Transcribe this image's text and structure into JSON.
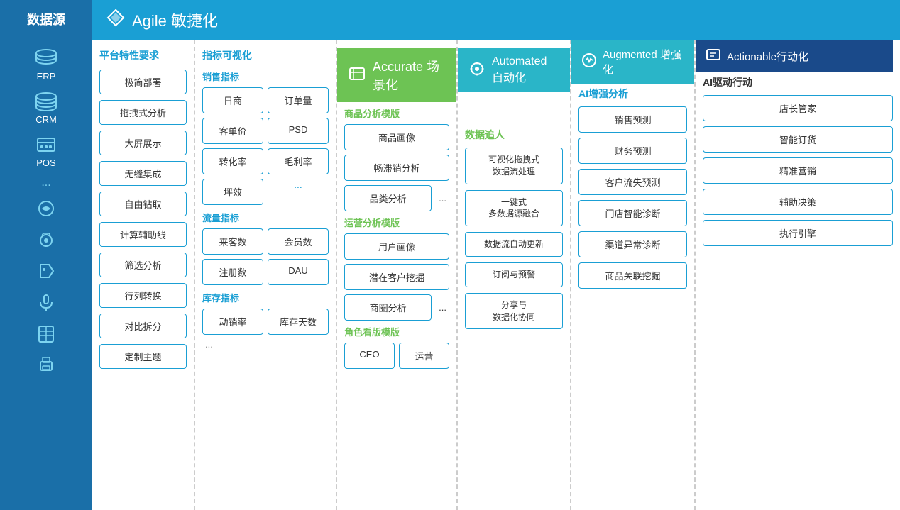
{
  "sidebar": {
    "title": "数据源",
    "items": [
      {
        "label": "ERP",
        "icon": "database"
      },
      {
        "label": "CRM",
        "icon": "database2"
      },
      {
        "label": "POS",
        "icon": "database3"
      },
      {
        "label": "...",
        "icon": "social"
      }
    ],
    "extra_icons": [
      "weibo",
      "camera",
      "tag",
      "mic",
      "excel",
      "print"
    ]
  },
  "top_header": {
    "icon": "navigation",
    "title": "Agile 敏捷化"
  },
  "platform": {
    "title": "平台特性要求",
    "features": [
      "极简部署",
      "拖拽式分析",
      "大屏展示",
      "无缝集成",
      "自由钻取",
      "计算辅助线",
      "筛选分析",
      "行列转换",
      "对比拆分",
      "定制主题"
    ]
  },
  "metrics": {
    "title": "指标可视化",
    "sales_title": "销售指标",
    "sales_items": [
      "日商",
      "订单量",
      "客单价",
      "PSD",
      "转化率",
      "毛利率",
      "坪效",
      "..."
    ],
    "traffic_title": "流量指标",
    "traffic_items": [
      "来客数",
      "会员数",
      "注册数",
      "DAU"
    ],
    "inventory_title": "库存指标",
    "inventory_items": [
      "动销率",
      "库存天数"
    ],
    "bottom_ellipsis": "..."
  },
  "accurate": {
    "header": "Accurate 场景化",
    "goods_title": "商品分析模版",
    "goods_items": [
      "商品画像",
      "畅滞销分析",
      "品类分析",
      "..."
    ],
    "ops_title": "运营分析模版",
    "ops_items": [
      "用户画像",
      "潜在客户挖掘",
      "商圈分析",
      "..."
    ],
    "role_title": "角色看版模版",
    "role_items": [
      "CEO",
      "运营"
    ]
  },
  "automated": {
    "header": "Automated 自动化",
    "tracking_title": "数据追人",
    "tracking_items": [
      "可视化拖拽式\n数据流处理",
      "一键式\n多数据源融合",
      "数据流自动更新",
      "订阅与预警",
      "分享与\n数据化协同"
    ]
  },
  "augmented": {
    "header": "Augmented 增强化",
    "ai_title": "AI增强分析",
    "ai_items": [
      "销售预测",
      "财务预测",
      "客户流失预测",
      "门店智能诊断",
      "渠道异常诊断",
      "商品关联挖掘"
    ]
  },
  "actionable": {
    "header": "Actionable行动化",
    "ai_drive_title": "AI驱动行动",
    "ai_drive_items": [
      "店长管家",
      "智能订货",
      "精准营销",
      "辅助决策",
      "执行引擎"
    ]
  }
}
